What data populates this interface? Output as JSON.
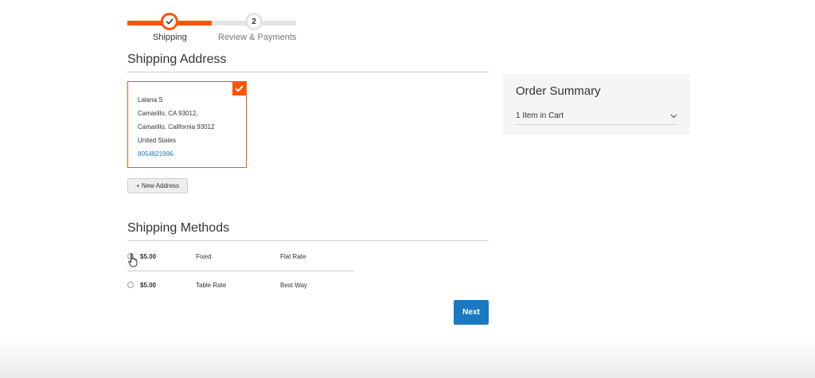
{
  "progress": {
    "steps": [
      {
        "number": "1",
        "label": "Shipping",
        "state": "complete"
      },
      {
        "number": "2",
        "label": "Review & Payments",
        "state": "pending"
      }
    ],
    "accent_color": "#ff5501"
  },
  "shipping_address": {
    "title": "Shipping Address",
    "selected_address": {
      "name": "Lalana S",
      "line1": "Camarillo, CA 93012,",
      "line2": "Camarillo, California 93012",
      "country": "United States",
      "phone": "8054821996"
    },
    "new_address_label": "+ New Address"
  },
  "shipping_methods": {
    "title": "Shipping Methods",
    "rows": [
      {
        "price": "$5.00",
        "method": "Fixed",
        "carrier": "Flat Rate",
        "selected": false
      },
      {
        "price": "$5.00",
        "method": "Table Rate",
        "carrier": "Best Way",
        "selected": false
      }
    ]
  },
  "next_label": "Next",
  "order_summary": {
    "title": "Order Summary",
    "items_label": "1 Item in Cart",
    "toggle_icon": "chevron-down-icon"
  },
  "colors": {
    "primary_button": "#1979c3",
    "accent": "#ff5501",
    "summary_bg": "#f5f5f5"
  }
}
